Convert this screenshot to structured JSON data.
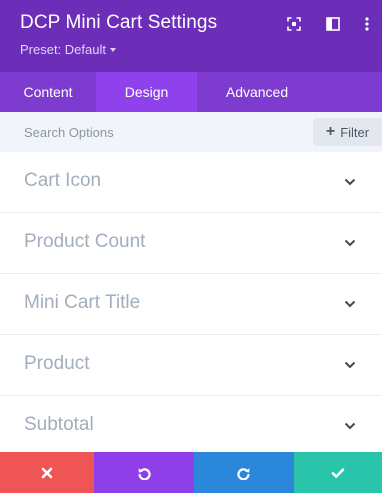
{
  "header": {
    "title": "DCP Mini Cart Settings",
    "preset_label": "Preset: Default",
    "icons": [
      "fullscreen-icon",
      "sidebar-layout-icon",
      "more-vertical-icon"
    ]
  },
  "tabs": [
    {
      "label": "Content",
      "active": false
    },
    {
      "label": "Design",
      "active": true
    },
    {
      "label": "Advanced",
      "active": false
    }
  ],
  "search": {
    "placeholder": "Search Options",
    "value": "",
    "filter_label": "Filter"
  },
  "sections": [
    {
      "label": "Cart Icon"
    },
    {
      "label": "Product Count"
    },
    {
      "label": "Mini Cart Title"
    },
    {
      "label": "Product"
    },
    {
      "label": "Subtotal"
    }
  ],
  "footer": [
    {
      "name": "discard",
      "icon": "close-icon",
      "color": "#ef5555"
    },
    {
      "name": "undo",
      "icon": "undo-icon",
      "color": "#8e3fe8"
    },
    {
      "name": "redo",
      "icon": "redo-icon",
      "color": "#2b87da"
    },
    {
      "name": "save",
      "icon": "check-icon",
      "color": "#29c4a9"
    }
  ],
  "colors": {
    "header_bg": "#6c2eb9",
    "tabs_bg": "#7e3bd0",
    "active_tab_bg": "#8f42ec"
  }
}
